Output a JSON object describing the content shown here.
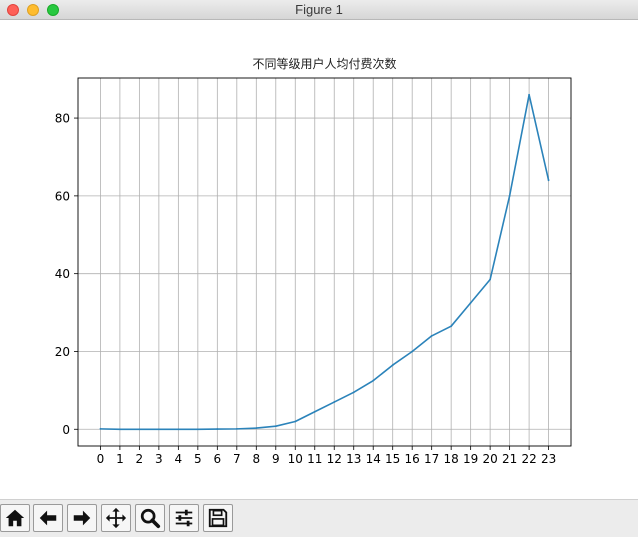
{
  "window": {
    "title": "Figure 1"
  },
  "toolbar": {
    "icons": [
      "home-icon",
      "back-arrow-icon",
      "forward-arrow-icon",
      "pan-move-icon",
      "zoom-magnifier-icon",
      "configure-subplots-icon",
      "save-floppy-icon"
    ]
  },
  "colors": {
    "series": "#2b83ba",
    "grid": "#b0b0b0"
  },
  "chart_data": {
    "type": "line",
    "title": "不同等级用户人均付费次数",
    "xlabel": "",
    "ylabel": "",
    "x": [
      0,
      1,
      2,
      3,
      4,
      5,
      6,
      7,
      8,
      9,
      10,
      11,
      12,
      13,
      14,
      15,
      16,
      17,
      18,
      19,
      20,
      21,
      22,
      23
    ],
    "series": [
      {
        "values": [
          0.1,
          0.0,
          0.0,
          0.0,
          0.0,
          0.0,
          0.05,
          0.1,
          0.3,
          0.8,
          2.0,
          4.5,
          7.0,
          9.5,
          12.5,
          16.5,
          20.0,
          24.0,
          26.5,
          32.5,
          38.5,
          60.0,
          86.0,
          64.0
        ]
      }
    ],
    "xticks": [
      "0",
      "1",
      "2",
      "3",
      "4",
      "5",
      "6",
      "7",
      "8",
      "9",
      "10",
      "11",
      "12",
      "13",
      "14",
      "15",
      "16",
      "17",
      "18",
      "19",
      "20",
      "21",
      "22",
      "23"
    ],
    "yticks": [
      "0",
      "20",
      "40",
      "60",
      "80"
    ],
    "xlim": [
      -1.15,
      24.15
    ],
    "ylim": [
      -4.3,
      90.3
    ],
    "grid": true,
    "legend": "none"
  }
}
